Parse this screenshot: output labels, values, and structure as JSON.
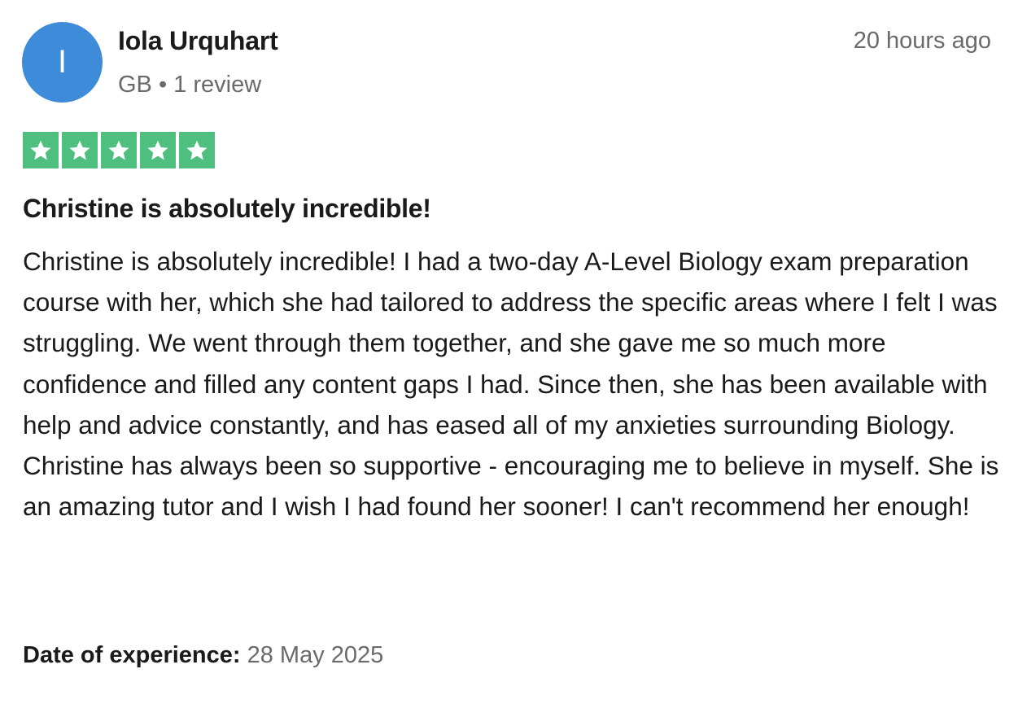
{
  "reviewer": {
    "initial": "I",
    "name": "Iola Urquhart",
    "meta": "GB • 1 review",
    "avatar_color": "#3d8bd9"
  },
  "review": {
    "posted": "20 hours ago",
    "rating": 5,
    "rating_max": 5,
    "star_color": "#4fbf7f",
    "star_icon": "star-icon",
    "title": "Christine is absolutely incredible!",
    "body": "Christine is absolutely incredible! I had a two-day A-Level Biology exam preparation course with her, which she had tailored to address the specific areas where I felt I was struggling. We went through them together, and she gave me so much more confidence and filled any content gaps I had. Since then, she has been available with help and advice constantly, and has eased all of my anxieties surrounding Biology. Christine has always been so supportive - encouraging me to believe in myself. She is an amazing tutor and I wish I had found her sooner! I can't recommend her enough!",
    "experience_label": "Date of experience:",
    "experience_date": "28 May 2025"
  }
}
